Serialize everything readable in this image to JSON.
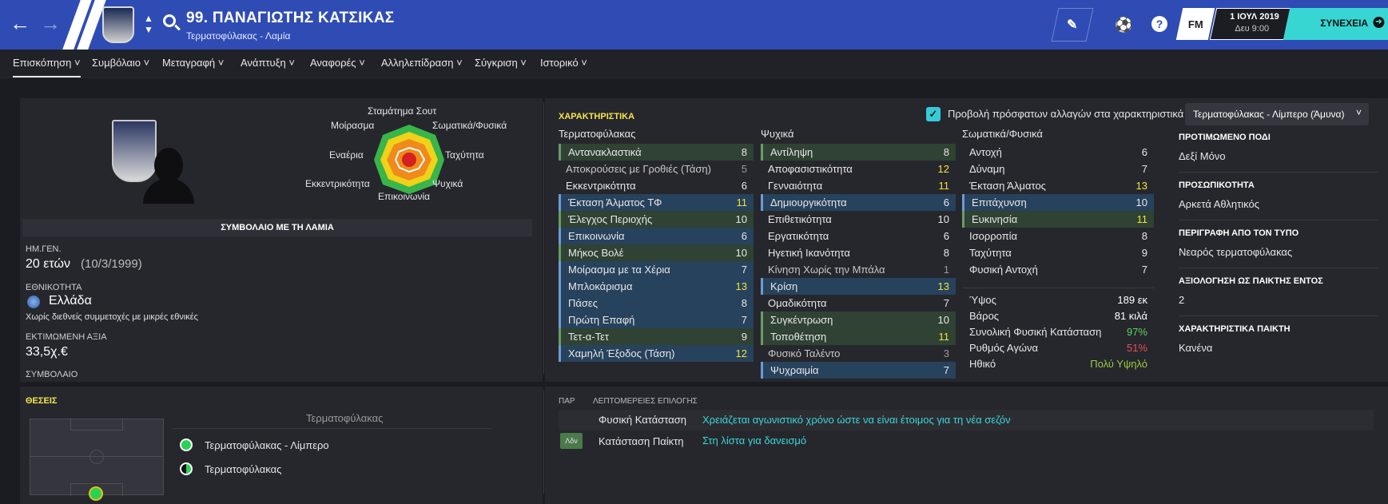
{
  "header": {
    "player_name": "99. ΠΑΝΑΓΙΩΤΗΣ ΚΑΤΣΙΚΑΣ",
    "player_role": "Τερματοφύλακας - Λαμία",
    "fm_label": "FM",
    "date": "1 ΙΟΥΛ 2019",
    "time": "Δευ 9:00",
    "continue_label": "ΣΥΝΕΧΕΙΑ"
  },
  "nav": [
    "Επισκόπηση",
    "Συμβόλαιο",
    "Μεταγραφή",
    "Ανάπτυξη",
    "Αναφορές",
    "Αλληλεπίδραση",
    "Σύγκριση",
    "Ιστορικό"
  ],
  "profile": {
    "contract_banner": "ΣΥΜΒΟΛΑΙΟ ΜΕ ΤΗ ΛΑΜΙΑ",
    "dob_label": "ΗΜ.ΓΕΝ.",
    "age": "20 ετών",
    "dob": "(10/3/1999)",
    "nationality_label": "ΕΘΝΙΚΟΤΗΤΑ",
    "nationality": "Ελλάδα",
    "caps_note": "Χωρίς διεθνείς συμμετοχές με μικρές εθνικές",
    "value_label": "ΕΚΤΙΜΩΜΕΝΗ ΑΞΙΑ",
    "value": "33,5χ.€",
    "contract_label": "ΣΥΜΒΟΛΑΙΟ"
  },
  "radar": {
    "labels": [
      "Σταμάτημα Σουτ",
      "Σωματικά/Φυσικά",
      "Ταχύτητα",
      "Ψυχικά",
      "Επικοινωνία",
      "Εκκεντρικότητα",
      "Εναέρια",
      "Μοίρασμα"
    ],
    "colors": [
      "#39b54a",
      "#f0d21a",
      "#f08a1a",
      "#d32020"
    ]
  },
  "attributes": {
    "title": "ΧΑΡΑΚΤΗΡΙΣΤΙΚΑ",
    "recent_changes_label": "Προβολή πρόσφατων αλλαγών στα χαρακτηριστικά",
    "role_select": "Τερματοφύλακας - Λίμπερο (Άμυνα)",
    "goalkeeping": {
      "header": "Τερματοφύλακας",
      "items": [
        {
          "name": "Αντανακλαστικά",
          "value": "8",
          "hl": "g"
        },
        {
          "name": "Αποκρούσεις με Γροθιές (Τάση)",
          "value": "5",
          "hl": "dim"
        },
        {
          "name": "Εκκεντρικότητα",
          "value": "6",
          "hl": ""
        },
        {
          "name": "Έκταση Άλματος ΤΦ",
          "value": "11",
          "hl": "b"
        },
        {
          "name": "Έλεγχος Περιοχής",
          "value": "10",
          "hl": "g"
        },
        {
          "name": "Επικοινωνία",
          "value": "6",
          "hl": "b"
        },
        {
          "name": "Μήκος Βολέ",
          "value": "10",
          "hl": "g"
        },
        {
          "name": "Μοίρασμα με τα Χέρια",
          "value": "7",
          "hl": "b"
        },
        {
          "name": "Μπλοκάρισμα",
          "value": "13",
          "hl": "b"
        },
        {
          "name": "Πάσες",
          "value": "8",
          "hl": "b"
        },
        {
          "name": "Πρώτη Επαφή",
          "value": "7",
          "hl": "b"
        },
        {
          "name": "Τετ-α-Τετ",
          "value": "9",
          "hl": "g"
        },
        {
          "name": "Χαμηλή Έξοδος (Τάση)",
          "value": "12",
          "hl": "b"
        }
      ]
    },
    "mental": {
      "header": "Ψυχικά",
      "items": [
        {
          "name": "Αντίληψη",
          "value": "8",
          "hl": "g"
        },
        {
          "name": "Αποφασιστικότητα",
          "value": "12",
          "hl": ""
        },
        {
          "name": "Γενναιότητα",
          "value": "11",
          "hl": ""
        },
        {
          "name": "Δημιουργικότητα",
          "value": "6",
          "hl": "b"
        },
        {
          "name": "Επιθετικότητα",
          "value": "10",
          "hl": ""
        },
        {
          "name": "Εργατικότητα",
          "value": "6",
          "hl": ""
        },
        {
          "name": "Ηγετική Ικανότητα",
          "value": "8",
          "hl": ""
        },
        {
          "name": "Κίνηση Χωρίς την Μπάλα",
          "value": "1",
          "hl": "dim"
        },
        {
          "name": "Κρίση",
          "value": "13",
          "hl": "b"
        },
        {
          "name": "Ομαδικότητα",
          "value": "7",
          "hl": ""
        },
        {
          "name": "Συγκέντρωση",
          "value": "10",
          "hl": "g"
        },
        {
          "name": "Τοποθέτηση",
          "value": "11",
          "hl": "g"
        },
        {
          "name": "Φυσικό Ταλέντο",
          "value": "3",
          "hl": "dim"
        },
        {
          "name": "Ψυχραιμία",
          "value": "7",
          "hl": "b"
        }
      ]
    },
    "physical": {
      "header": "Σωματικά/Φυσικά",
      "items": [
        {
          "name": "Αντοχή",
          "value": "6",
          "hl": ""
        },
        {
          "name": "Δύναμη",
          "value": "7",
          "hl": ""
        },
        {
          "name": "Έκταση Άλματος",
          "value": "13",
          "hl": ""
        },
        {
          "name": "Επιτάχυνση",
          "value": "10",
          "hl": "b"
        },
        {
          "name": "Ευκινησία",
          "value": "11",
          "hl": "g"
        },
        {
          "name": "Ισορροπία",
          "value": "8",
          "hl": ""
        },
        {
          "name": "Ταχύτητα",
          "value": "9",
          "hl": ""
        },
        {
          "name": "Φυσική Αντοχή",
          "value": "7",
          "hl": ""
        }
      ]
    },
    "stats": [
      {
        "name": "Ύψος",
        "value": "189 εκ",
        "color": "#ffffff"
      },
      {
        "name": "Βάρος",
        "value": "81 κιλά",
        "color": "#ffffff"
      },
      {
        "name": "Συνολική Φυσική Κατάσταση",
        "value": "97%",
        "color": "#5fd35f"
      },
      {
        "name": "Ρυθμός Αγώνα",
        "value": "51%",
        "color": "#e85050"
      },
      {
        "name": "Ηθικό",
        "value": "Πολύ Υψηλό",
        "color": "#9ccc3c"
      }
    ]
  },
  "info": [
    {
      "label": "ΠΡΟΤΙΜΩΜΕΝΟ ΠΟΔΙ",
      "value": "Δεξί Μόνο"
    },
    {
      "label": "ΠΡΟΣΩΠΙΚΟΤΗΤΑ",
      "value": "Αρκετά Αθλητικός"
    },
    {
      "label": "ΠΕΡΙΓΡΑΦΗ ΑΠΟ ΤΟΝ ΤΥΠΟ",
      "value": "Νεαρός τερματοφύλακας"
    },
    {
      "label": "ΑΞΙΟΛΟΓΗΣΗ ΩΣ ΠΑΙΚΤΗΣ ΕΝΤΟΣ",
      "value": "2"
    },
    {
      "label": "ΧΑΡΑΚΤΗΡΙΣΤΙΚΑ ΠΑΙΚΤΗ",
      "value": "Κανένα"
    }
  ],
  "positions": {
    "title": "ΘΕΣΕΙΣ",
    "subtitle": "Τερματοφύλακας",
    "items": [
      "Τερματοφύλακας - Λίμπερο",
      "Τερματοφύλακας"
    ]
  },
  "selection": {
    "col1": "ΠΑΡ",
    "col2": "ΛΕΠΤΟΜΕΡΕΙΕΣ ΕΠΙΛΟΓΗΣ",
    "rows": [
      {
        "badge": "",
        "label": "Φυσική Κατάσταση",
        "value": "Χρειάζεται αγωνιστικό χρόνο ώστε να είναι έτοιμος για τη νέα σεζόν"
      },
      {
        "badge": "Λδν",
        "label": "Κατάσταση Παίκτη",
        "value": "Στη λίστα για δανεισμό"
      }
    ]
  }
}
